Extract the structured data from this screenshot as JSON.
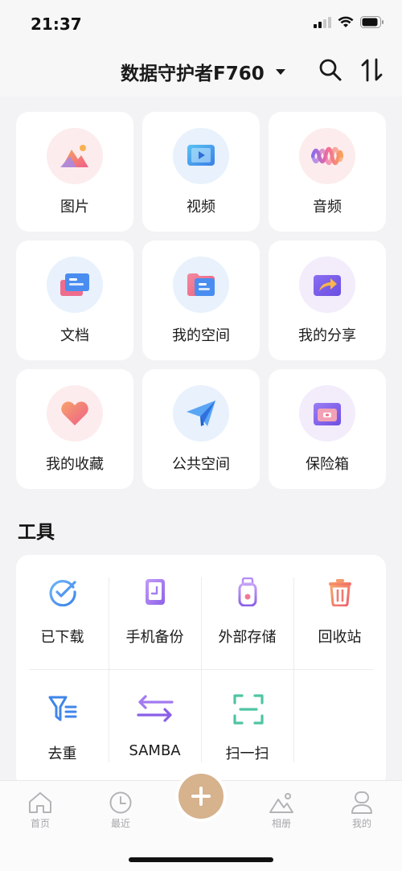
{
  "status_bar": {
    "time": "21:37"
  },
  "header": {
    "device_name": "数据守护者F760"
  },
  "categories": [
    {
      "label": "图片",
      "icon": "image-icon"
    },
    {
      "label": "视频",
      "icon": "video-icon"
    },
    {
      "label": "音频",
      "icon": "audio-icon"
    },
    {
      "label": "文档",
      "icon": "document-icon"
    },
    {
      "label": "我的空间",
      "icon": "folder-icon"
    },
    {
      "label": "我的分享",
      "icon": "share-icon"
    },
    {
      "label": "我的收藏",
      "icon": "heart-icon"
    },
    {
      "label": "公共空间",
      "icon": "paper-plane-icon"
    },
    {
      "label": "保险箱",
      "icon": "safe-icon"
    }
  ],
  "tools": {
    "title": "工具",
    "items": [
      {
        "label": "已下载",
        "icon": "downloaded-check-icon"
      },
      {
        "label": "手机备份",
        "icon": "phone-backup-icon"
      },
      {
        "label": "外部存储",
        "icon": "usb-drive-icon"
      },
      {
        "label": "回收站",
        "icon": "trash-icon"
      },
      {
        "label": "去重",
        "icon": "dedupe-filter-icon"
      },
      {
        "label": "SAMBA",
        "icon": "swap-arrows-icon"
      },
      {
        "label": "扫一扫",
        "icon": "scan-icon"
      }
    ]
  },
  "tab_bar": {
    "items": [
      {
        "label": "首页",
        "icon": "home-icon"
      },
      {
        "label": "最近",
        "icon": "clock-icon"
      },
      {
        "label": "相册",
        "icon": "album-icon"
      },
      {
        "label": "我的",
        "icon": "profile-icon"
      }
    ],
    "fab_icon": "plus-icon"
  },
  "colors": {
    "accent_fab": "#d6b28d",
    "background": "#f3f3f5",
    "card": "#ffffff"
  }
}
